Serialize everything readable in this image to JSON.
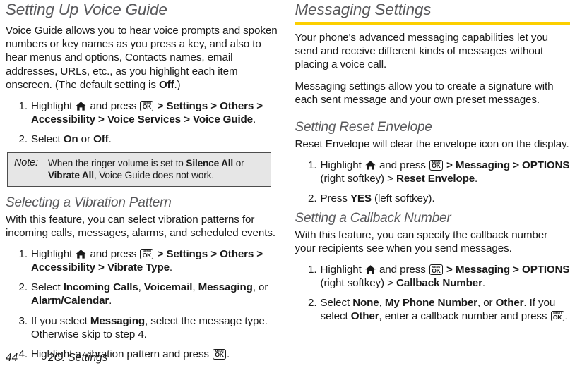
{
  "footer": {
    "page_number": "44",
    "chapter": "2C. Settings"
  },
  "theme": {
    "accent_rule": "#fccf00",
    "heading_gray": "#58585b",
    "note_bg": "#e6e6e6",
    "note_border": "#4d4d4d",
    "body_text": "#1a1a1a"
  },
  "icons": {
    "home": "home-icon",
    "menu_ok": "menu-ok-key-icon",
    "menu_ok_top_label": "MENU",
    "menu_ok_main_label": "OK"
  },
  "left_column": {
    "heading": "Setting Up Voice Guide",
    "intro": {
      "t1": "Voice Guide allows you to hear voice prompts and spoken numbers or key names as you press a key, and also to hear menus and options, Contacts names, email addresses, URLs, etc., as you highlight each item onscreen. (The default setting is ",
      "bold1": "Off",
      "t2": ".)"
    },
    "steps": [
      {
        "num": "1.",
        "t1": "Highlight ",
        "t2": " and press ",
        "t3": " > ",
        "b1": "Settings",
        "t4": " > ",
        "b2": "Others",
        "t5": " > ",
        "b3": "Accessibility",
        "t6": " > ",
        "b4": "Voice Services",
        "t7": " > ",
        "b5": "Voice Guide",
        "t8": "."
      },
      {
        "num": "2.",
        "t1": "Select ",
        "b1": "On",
        "t2": " or ",
        "b2": "Off",
        "t3": "."
      }
    ],
    "note": {
      "label": "Note:",
      "l1_t1": "When the ringer volume is set to ",
      "l1_b1": "Silence All",
      "l1_t2": " or",
      "l2_b1": "Vibrate All",
      "l2_t1": ", Voice Guide does not work."
    },
    "subsection": {
      "heading": "Selecting a Vibration Pattern",
      "intro": "With this feature, you can select vibration patterns for incoming calls, messages, alarms, and scheduled events.",
      "steps": [
        {
          "num": "1.",
          "t1": "Highlight ",
          "t2": " and press ",
          "t3": " > ",
          "b1": "Settings",
          "t4": " > ",
          "b2": "Others",
          "t5": " > ",
          "b3": "Accessibility",
          "t6": " > ",
          "b4": "Vibrate Type",
          "t7": "."
        },
        {
          "num": "2.",
          "t1": "Select ",
          "b1": "Incoming Calls",
          "t2": ", ",
          "b2": "Voicemail",
          "t3": ", ",
          "b3": "Messaging",
          "t4": ", or ",
          "b4": "Alarm/Calendar",
          "t5": "."
        },
        {
          "num": "3.",
          "t1": "If you select ",
          "b1": "Messaging",
          "t2": ", select the message type. Otherwise skip to step 4."
        },
        {
          "num": "4.",
          "t1": "Highlight a vibration pattern and press ",
          "t2": "."
        }
      ]
    }
  },
  "right_column": {
    "heading": "Messaging Settings",
    "intro1": "Your phone's advanced messaging capabilities let you send and receive different kinds of messages without placing a voice call.",
    "intro2": "Messaging settings allow you to create a signature with each sent message and your own preset messages.",
    "sections": [
      {
        "heading": "Setting Reset Envelope",
        "intro": "Reset Envelope will clear the envelope icon on the display.",
        "steps": [
          {
            "num": "1.",
            "t1": "Highlight ",
            "t2": " and press ",
            "t3": " > ",
            "b1": "Messaging",
            "t4": " > ",
            "b2": "OPTIONS",
            "t5": " (right softkey) > ",
            "b3": "Reset Envelope",
            "t6": "."
          },
          {
            "num": "2.",
            "t1": "Press ",
            "b1": "YES",
            "t2": " (left softkey)."
          }
        ]
      },
      {
        "heading": "Setting a Callback Number",
        "intro": "With this feature, you can specify the callback number your recipients see when you send messages.",
        "steps": [
          {
            "num": "1.",
            "t1": "Highlight ",
            "t2": " and press ",
            "t3": " > ",
            "b1": "Messaging",
            "t4": " > ",
            "b2": "OPTIONS",
            "t5": " (right softkey) > ",
            "b3": "Callback Number",
            "t6": "."
          },
          {
            "num": "2.",
            "t1": "Select ",
            "b1": "None",
            "t2": ", ",
            "b2": "My Phone Number",
            "t3": ", or ",
            "b3": "Other",
            "t4": ". If you select ",
            "b4": "Other",
            "t5": ", enter a callback number and press ",
            "t6": "."
          }
        ]
      }
    ]
  }
}
